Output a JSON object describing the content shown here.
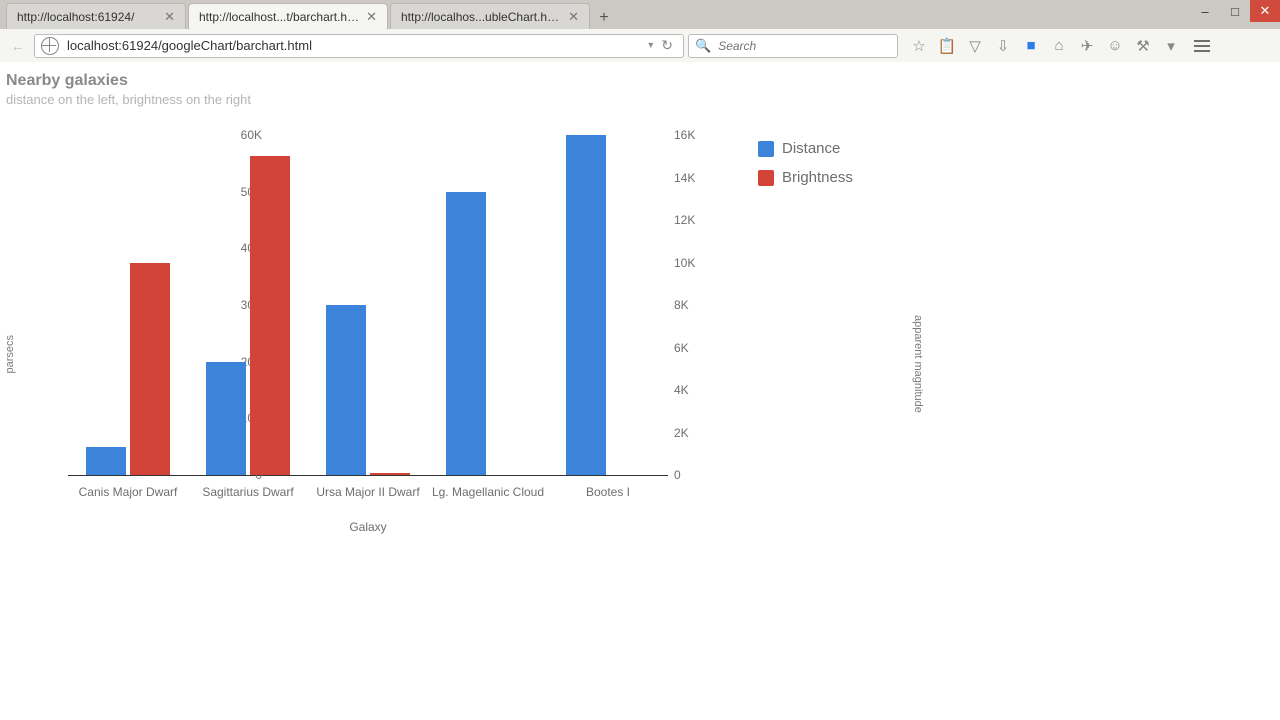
{
  "window": {
    "tabs": [
      {
        "label": "http://localhost:61924/",
        "active": false
      },
      {
        "label": "http://localhost...t/barchart.html",
        "active": true
      },
      {
        "label": "http://localhos...ubleChart.html",
        "active": false
      }
    ],
    "url": "localhost:61924/googleChart/barchart.html",
    "search_placeholder": "Search"
  },
  "chart_data": {
    "type": "bar",
    "title": "Nearby galaxies",
    "subtitle": "distance on the left, brightness on the right",
    "xlabel": "Galaxy",
    "y_left": {
      "label": "parsecs",
      "min": 0,
      "max": 60000,
      "ticks": [
        0,
        10000,
        20000,
        30000,
        40000,
        50000,
        60000
      ],
      "tick_labels": [
        "0",
        "10K",
        "20K",
        "30K",
        "40K",
        "50K",
        "60K"
      ]
    },
    "y_right": {
      "label": "apparent magnitude",
      "min": 0,
      "max": 16000,
      "ticks": [
        0,
        2000,
        4000,
        6000,
        8000,
        10000,
        12000,
        14000,
        16000
      ],
      "tick_labels": [
        "0",
        "2K",
        "4K",
        "6K",
        "8K",
        "10K",
        "12K",
        "14K",
        "16K"
      ]
    },
    "categories": [
      "Canis Major Dwarf",
      "Sagittarius Dwarf",
      "Ursa Major II Dwarf",
      "Lg. Magellanic Cloud",
      "Bootes I"
    ],
    "series": [
      {
        "name": "Distance",
        "axis": "left",
        "color": "#3b84d9",
        "values": [
          5000,
          20000,
          30000,
          50000,
          60000
        ]
      },
      {
        "name": "Brightness",
        "axis": "right",
        "color": "#d24338",
        "values": [
          10000,
          15000,
          100,
          0,
          0
        ]
      }
    ],
    "legend": [
      "Distance",
      "Brightness"
    ]
  }
}
